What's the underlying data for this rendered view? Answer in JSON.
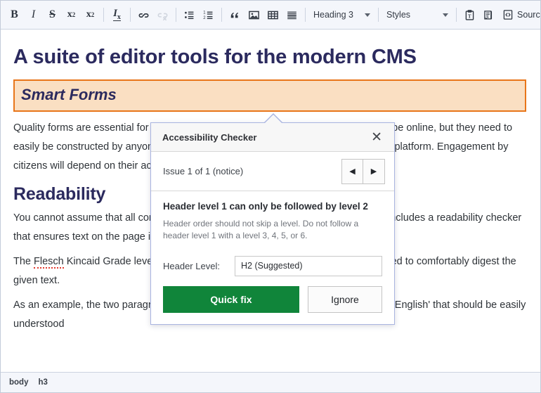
{
  "toolbar": {
    "groups": [
      {
        "items": [
          {
            "name": "bold-button",
            "label": "B",
            "icon": "bold-icon",
            "enabled": true
          },
          {
            "name": "italic-button",
            "label": "I",
            "icon": "italic-icon",
            "enabled": true
          },
          {
            "name": "strikethrough-button",
            "label": "S",
            "icon": "strikethrough-icon",
            "enabled": true
          },
          {
            "name": "superscript-button",
            "label": "x²",
            "icon": "superscript-icon",
            "enabled": true
          },
          {
            "name": "subscript-button",
            "label": "x₂",
            "icon": "subscript-icon",
            "enabled": true
          }
        ]
      },
      {
        "items": [
          {
            "name": "remove-format-button",
            "label": "Ix",
            "icon": "remove-format-icon",
            "enabled": true
          }
        ]
      },
      {
        "items": [
          {
            "name": "link-button",
            "label": "Link",
            "icon": "link-icon",
            "enabled": true
          },
          {
            "name": "unlink-button",
            "label": "Unlink",
            "icon": "unlink-icon",
            "enabled": false
          }
        ]
      },
      {
        "items": [
          {
            "name": "bulleted-list-button",
            "label": "Insert/Remove Bulleted List",
            "icon": "bulleted-list-icon",
            "enabled": true
          },
          {
            "name": "numbered-list-button",
            "label": "Insert/Remove Numbered List",
            "icon": "numbered-list-icon",
            "enabled": true
          }
        ]
      },
      {
        "items": [
          {
            "name": "blockquote-button",
            "label": "Block Quote",
            "icon": "quote-icon",
            "enabled": true
          },
          {
            "name": "image-button",
            "label": "Image",
            "icon": "image-icon",
            "enabled": true
          },
          {
            "name": "table-button",
            "label": "Table",
            "icon": "table-icon",
            "enabled": true
          },
          {
            "name": "horizontal-rule-button",
            "label": "Horizontal Line",
            "icon": "horizontal-rule-icon",
            "enabled": true
          }
        ]
      }
    ],
    "format_dropdown": {
      "label": "Heading 3",
      "icon": "chevron-down-icon"
    },
    "styles_dropdown": {
      "label": "Styles",
      "icon": "chevron-down-icon"
    },
    "paste_text_button": {
      "label": "Paste as plain text",
      "icon": "paste-text-icon"
    },
    "spellcheck_button": {
      "label": "Spell Check As You Type",
      "icon": "spellcheck-icon"
    },
    "source_button": {
      "label": "Source",
      "icon": "source-code-icon"
    },
    "accessibility_button": {
      "label": "Accessibility Checker",
      "icon": "accessibility-icon",
      "active": true
    }
  },
  "document": {
    "title": "A suite of editor tools for the modern CMS",
    "selected_heading": "Smart Forms",
    "paragraph_1": "Quality forms are essential for government digital services. Interactions that used to be online, but they need to easily be constructed by anyone with the right permissions and deployed to the right platform. Engagement by citizens will depend on their accessibility, ease of use and motivation.",
    "section_heading": "Readability",
    "paragraph_2": "You cannot assume that all content authors write with plain language. District CMS includes a readability checker that ensures text on the page is matched to the public's reading ability.",
    "paragraph_3_pre": "The ",
    "paragraph_3_misspelled": "Flesch",
    "paragraph_3_post": " Kincaid Grade level test is a formula that indicates the grade level required to comfortably digest the given text.",
    "paragraph_4": "As an example, the two paragraphs above would be classified in few words as 'plain English' that should be easily understood"
  },
  "panel": {
    "title": "Accessibility Checker",
    "close_label": "✕",
    "issue_counter": "Issue 1 of 1 (notice)",
    "prev_label": "◀",
    "next_label": "▶",
    "issue_title": "Header level 1 can only be followed by level 2",
    "issue_description": "Header order should not skip a level. Do not follow a header level 1 with a level 3, 4, 5, or 6.",
    "field_label": "Header Level:",
    "field_value": "H2 (Suggested)",
    "quick_fix_label": "Quick fix",
    "ignore_label": "Ignore"
  },
  "statusbar": {
    "path": [
      "body",
      "h3"
    ]
  },
  "colors": {
    "heading": "#2b2a5e",
    "selection_bg": "#fadfc2",
    "selection_border": "#e8761a",
    "quick_fix_green": "#10853a",
    "toolbar_bg": "#f4f6fb",
    "panel_border": "#a9b4e0",
    "misspell_underline": "#e2392e"
  }
}
